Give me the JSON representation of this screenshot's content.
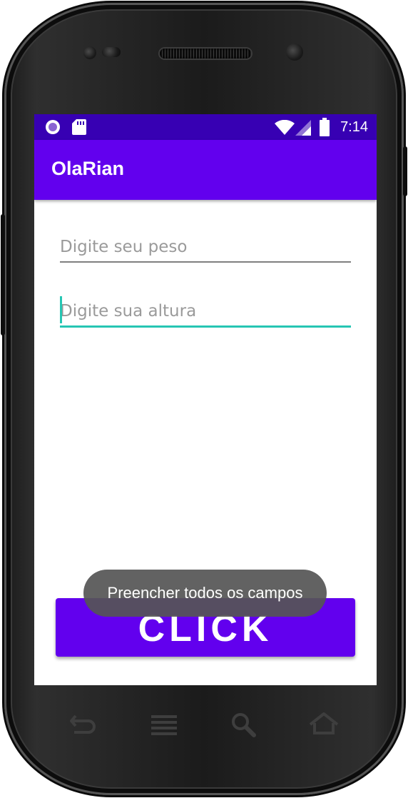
{
  "status_bar": {
    "time": "7:14",
    "icons": [
      "notification-dot-icon",
      "sd-card-icon",
      "wifi-icon",
      "cell-signal-icon",
      "battery-icon"
    ]
  },
  "app_bar": {
    "title": "OlaRian"
  },
  "form": {
    "weight_field": {
      "placeholder": "Digite seu peso",
      "value": ""
    },
    "height_field": {
      "placeholder": "Digite sua altura",
      "value": ""
    }
  },
  "action_button": {
    "label": "CLICK"
  },
  "toast": {
    "message": "Preencher todos os campos"
  },
  "nav_keys": [
    "back-icon",
    "menu-icon",
    "search-icon",
    "home-icon"
  ],
  "colors": {
    "status_bar": "#3700b3",
    "primary": "#6200ee",
    "accent": "#26c6b3"
  }
}
